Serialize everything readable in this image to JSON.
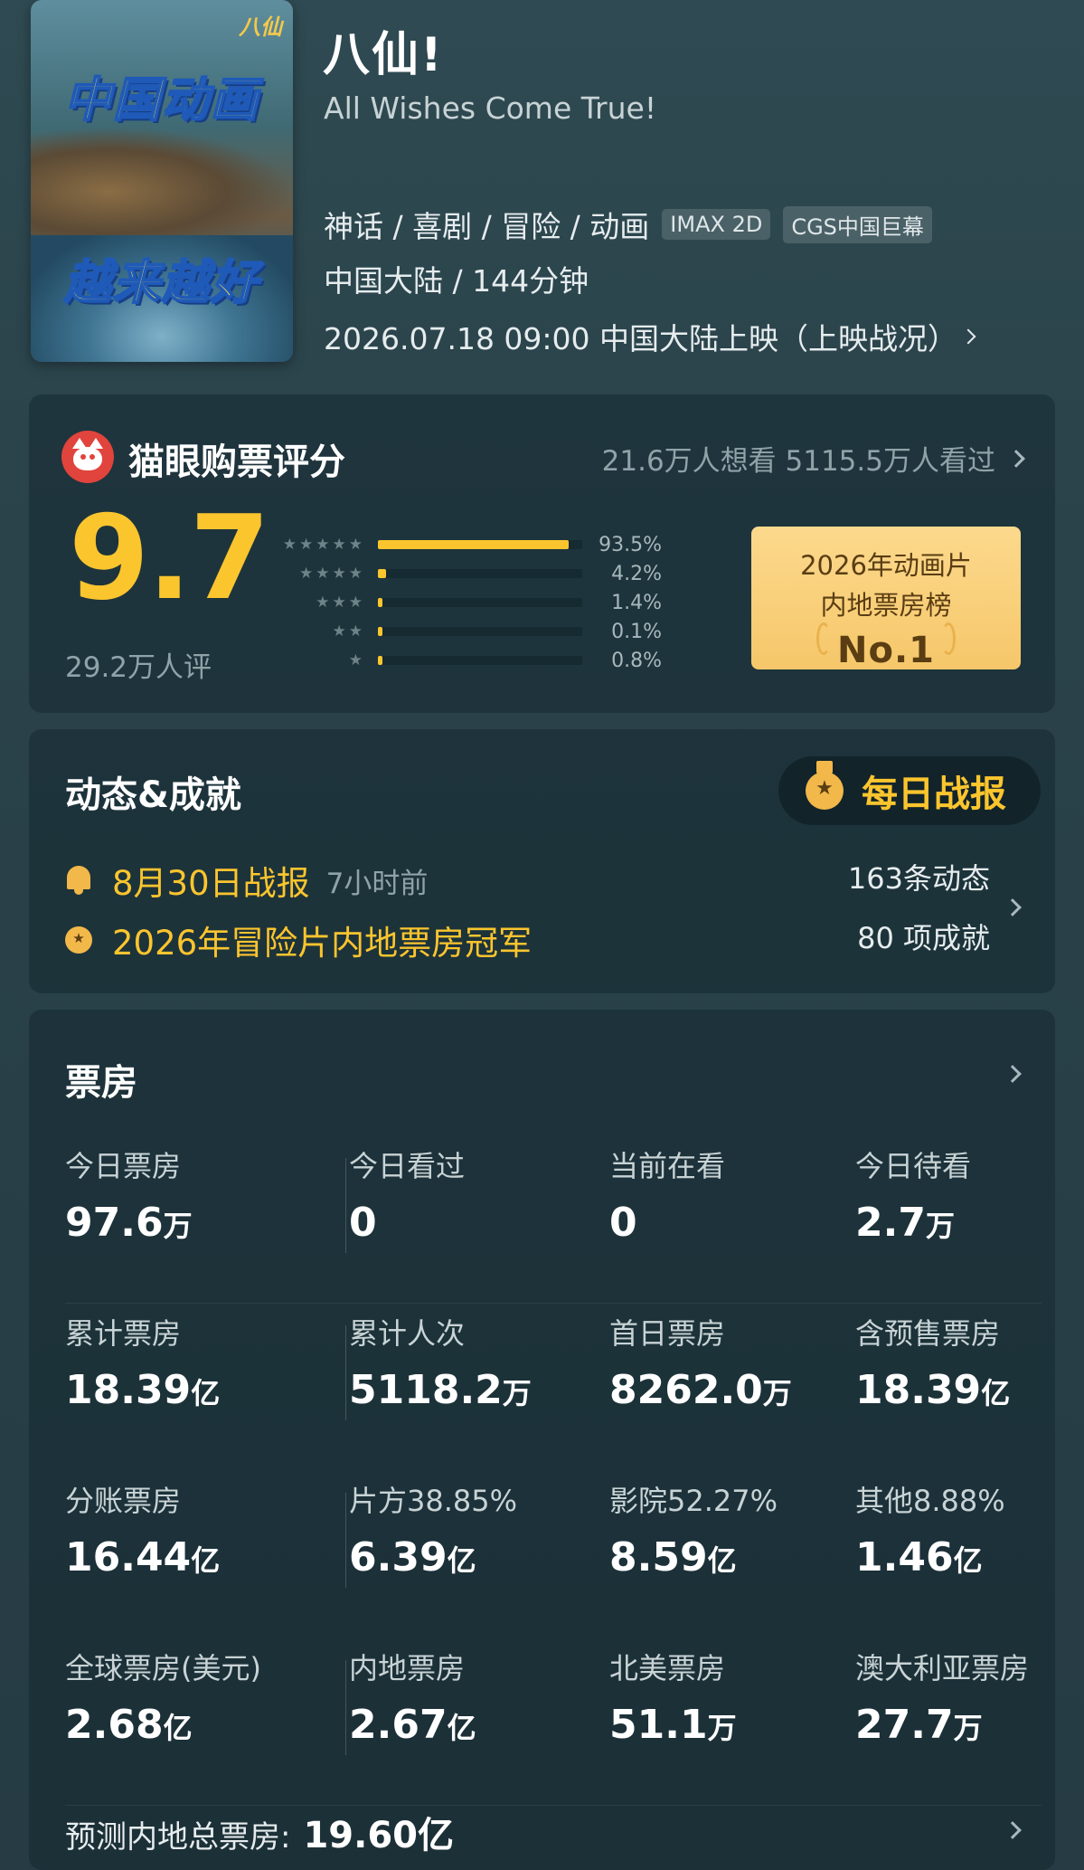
{
  "movie": {
    "poster_logo": "八仙",
    "poster_line1": "中国动画",
    "poster_line2": "越来越好",
    "title": "八仙!",
    "subtitle": "All Wishes Come True!",
    "genres": "神话 / 喜剧 / 冒险 / 动画",
    "tag1": "IMAX 2D",
    "tag2": "CGS中国巨幕",
    "meta": "中国大陆 / 144分钟",
    "release": "2026.07.18 09:00 中国大陆上映（上映战况）"
  },
  "rating": {
    "title": "猫眼购票评分",
    "stats": "21.6万人想看 5115.5万人看过",
    "score": "9.7",
    "count": "29.2万人评",
    "distribution": [
      {
        "stars": "★★★★★",
        "pct_label": "93.5%",
        "fraction": 0.935
      },
      {
        "stars": "★★★★",
        "pct_label": "4.2%",
        "fraction": 0.042
      },
      {
        "stars": "★★★",
        "pct_label": "1.4%",
        "fraction": 0.014
      },
      {
        "stars": "★★",
        "pct_label": "0.1%",
        "fraction": 0.001
      },
      {
        "stars": "★",
        "pct_label": "0.8%",
        "fraction": 0.008
      }
    ],
    "rank_line1": "2026年动画片",
    "rank_line2": "内地票房榜",
    "rank_no": "No.1"
  },
  "dynamics": {
    "title": "动态&成就",
    "daily_button": "每日战报",
    "report": "8月30日战报",
    "report_time": "7小时前",
    "champion": "2026年冒险片内地票房冠军",
    "news_count": "163条动态",
    "achievements": "80 项成就"
  },
  "box_office": {
    "title": "票房",
    "rows": [
      [
        {
          "label": "今日票房",
          "num": "97.6",
          "unit": "万"
        },
        {
          "label": "今日看过",
          "num": "0",
          "unit": ""
        },
        {
          "label": "当前在看",
          "num": "0",
          "unit": ""
        },
        {
          "label": "今日待看",
          "num": "2.7",
          "unit": "万"
        }
      ],
      [
        {
          "label": "累计票房",
          "num": "18.39",
          "unit": "亿"
        },
        {
          "label": "累计人次",
          "num": "5118.2",
          "unit": "万"
        },
        {
          "label": "首日票房",
          "num": "8262.0",
          "unit": "万"
        },
        {
          "label": "含预售票房",
          "num": "18.39",
          "unit": "亿"
        }
      ],
      [
        {
          "label": "分账票房",
          "num": "16.44",
          "unit": "亿"
        },
        {
          "label": "片方38.85%",
          "num": "6.39",
          "unit": "亿"
        },
        {
          "label": "影院52.27%",
          "num": "8.59",
          "unit": "亿"
        },
        {
          "label": "其他8.88%",
          "num": "1.46",
          "unit": "亿"
        }
      ],
      [
        {
          "label": "全球票房(美元)",
          "num": "2.68",
          "unit": "亿"
        },
        {
          "label": "内地票房",
          "num": "2.67",
          "unit": "亿"
        },
        {
          "label": "北美票房",
          "num": "51.1",
          "unit": "万"
        },
        {
          "label": "澳大利亚票房",
          "num": "27.7",
          "unit": "万"
        }
      ]
    ],
    "forecast_label": "预测内地总票房:",
    "forecast_value": "19.60亿"
  },
  "colors": {
    "accent": "#fbc52e",
    "background": "#2c454d",
    "card": "#1a3038",
    "brand_red": "#e0443c"
  },
  "icons": [
    "maoyan-cat-icon",
    "chevron-right-icon",
    "medal-icon",
    "bell-icon",
    "star-icon"
  ]
}
